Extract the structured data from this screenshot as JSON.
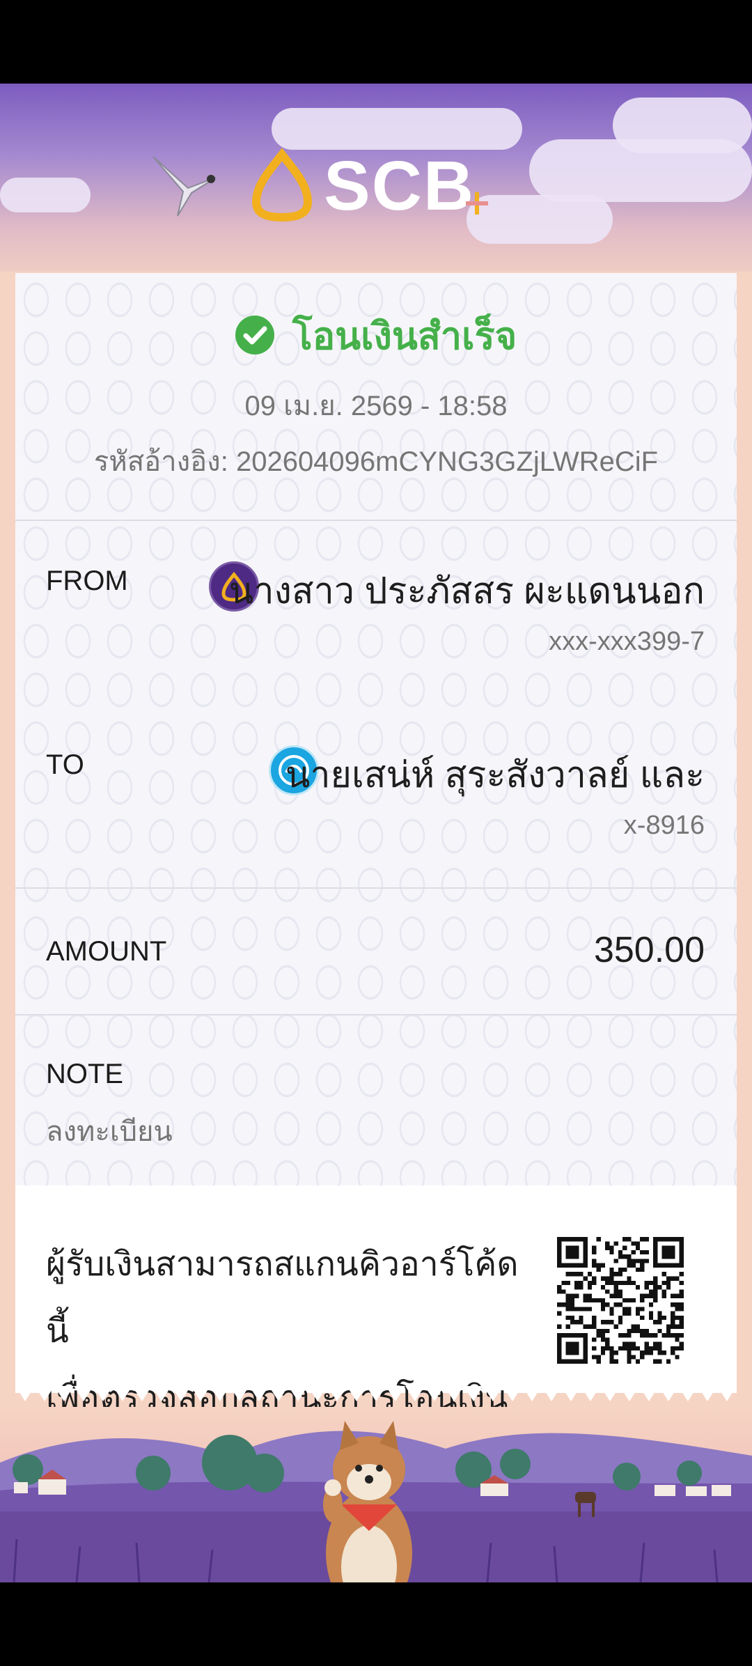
{
  "brand": {
    "name": "SCB"
  },
  "receipt": {
    "status": "โอนเงินสำเร็จ",
    "datetime": "09 เม.ย. 2569 - 18:58",
    "reference_label": "รหัสอ้างอิง:",
    "reference_value": "202604096mCYNG3GZjLWReCiF",
    "from": {
      "label": "FROM",
      "name": "นางสาว ประภัสสร ผะแดนนอก",
      "account": "xxx-xxx399-7",
      "bank_color": "#4e2a84"
    },
    "to": {
      "label": "TO",
      "name": "นายเสน่ห์ สุระสังวาลย์ และ",
      "account": "x-8916",
      "bank_color": "#1ba5e1"
    },
    "amount": {
      "label": "AMOUNT",
      "value": "350.00"
    },
    "note": {
      "label": "NOTE",
      "value": "ลงทะเบียน"
    },
    "qr_caption": "ผู้รับเงินสามารถสแกนคิวอาร์โค้ดนี้เพื่อตรวจสอบสถานะการโอนเงิน",
    "qr_caption_lines": [
      "ผู้รับเงินสามารถสแกนคิวอาร์โค้ดนี้",
      "เพื่อตรวจสอบสถานะการโอนเงิน"
    ]
  },
  "colors": {
    "success": "#45b04a",
    "header_purple": "#7d5cc0",
    "logo_gold": "#f2b01e",
    "peach": "#f6d4c4"
  },
  "icons": [
    "success-check-icon",
    "scb-bank-icon",
    "ktb-bank-icon",
    "qr-code-icon"
  ]
}
